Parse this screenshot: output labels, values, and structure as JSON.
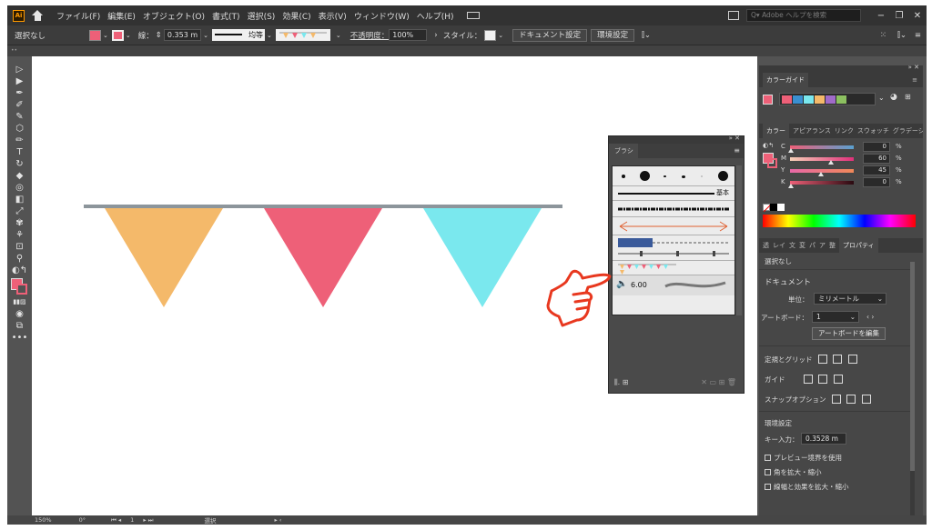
{
  "menubar": {
    "logo": "Ai",
    "items": [
      "ファイル(F)",
      "編集(E)",
      "オブジェクト(O)",
      "書式(T)",
      "選択(S)",
      "効果(C)",
      "表示(V)",
      "ウィンドウ(W)",
      "ヘルプ(H)"
    ],
    "search_placeholder": "Adobe ヘルプを検索",
    "win_min": "−",
    "win_restore": "❐",
    "win_close": "✕"
  },
  "controlbar": {
    "selection": "選択なし",
    "stroke_label": "線：",
    "stroke_value": "0.353 m",
    "stroke_profile": "均等",
    "opacity_label": "不透明度：",
    "opacity_value": "100%",
    "style_label": "スタイル：",
    "doc_setup": "ドキュメント設定",
    "preferences": "環境設定"
  },
  "statusbar": {
    "zoom": "150%",
    "rotation": "0°",
    "artboard": "1",
    "tool": "選択"
  },
  "brush_panel": {
    "tab": "ブラシ",
    "basic_label": "基本",
    "size_value": "6.00",
    "footer_left": "⫼. ⊞",
    "footer_right": "✕ ▭ ⊞ 🗑"
  },
  "color_guide": {
    "tab": "カラーガイド",
    "swatches": [
      "#ee6078",
      "#3a8fd0",
      "#7ae8ee",
      "#f4b96a",
      "#a06bc8",
      "#8cc060"
    ]
  },
  "color_panel": {
    "tabs": [
      "カラー",
      "アピアランス",
      "リンク",
      "スウォッチ",
      "グラデーション"
    ],
    "active_tab": "カラー",
    "cmyk": [
      {
        "label": "C",
        "value": "0"
      },
      {
        "label": "M",
        "value": "60"
      },
      {
        "label": "Y",
        "value": "45"
      },
      {
        "label": "K",
        "value": "0"
      }
    ],
    "pct": "%"
  },
  "properties": {
    "tabs": [
      "透",
      "レイ",
      "文",
      "変",
      "パ",
      "ア",
      "整",
      "プロパティ"
    ],
    "no_selection": "選択なし",
    "document_heading": "ドキュメント",
    "units_label": "単位：",
    "units_value": "ミリメートル",
    "artboard_label": "アートボード：",
    "artboard_value": "1",
    "edit_artboard": "アートボードを編集",
    "rulers_grids": "定規とグリッド",
    "guides": "ガイド",
    "snap_options": "スナップオプション",
    "preferences_heading": "環境設定",
    "key_increment_label": "キー入力：",
    "key_increment_value": "0.3528 m",
    "preview_bounds": "プレビュー境界を使用",
    "scale_corners": "角を拡大・縮小",
    "scale_strokes": "線幅と効果を拡大・縮小"
  },
  "bunting": {
    "string_color": "#8c959b",
    "flag_colors": [
      "#f4b96a",
      "#ee6078",
      "#7ae8ee"
    ]
  },
  "pointer": {
    "color": "#e8381f"
  }
}
